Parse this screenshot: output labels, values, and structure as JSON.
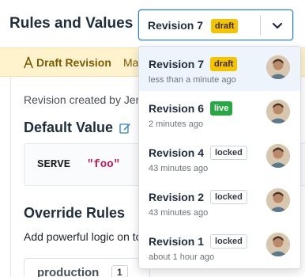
{
  "header": {
    "title": "Rules and Values"
  },
  "revision_select": {
    "selected_label": "Revision 7",
    "selected_badge": "draft",
    "chevron_icon": "chevron-down-icon"
  },
  "draft_banner": {
    "icon": "draft-icon",
    "title": "Draft Revision",
    "action_text": "Ma"
  },
  "content": {
    "created_text": "Revision created by Jer",
    "default_value_title": "Default Value",
    "edit_icon": "pencil-icon",
    "serve_keyword": "SERVE",
    "serve_value": "\"foo\"",
    "override_title": "Override Rules",
    "override_desc": "Add powerful logic on to",
    "env_tab": {
      "name": "production",
      "count": "1"
    }
  },
  "revisions": [
    {
      "label": "Revision 7",
      "badge": "draft",
      "time": "less than a minute ago",
      "active": true
    },
    {
      "label": "Revision 6",
      "badge": "live",
      "time": "2 minutes ago",
      "active": false
    },
    {
      "label": "Revision 4",
      "badge": "locked",
      "time": "43 minutes ago",
      "active": false
    },
    {
      "label": "Revision 2",
      "badge": "locked",
      "time": "43 minutes ago",
      "active": false
    },
    {
      "label": "Revision 1",
      "badge": "locked",
      "time": "about 1 hour ago",
      "active": false
    }
  ],
  "colors": {
    "accent": "#2f80c9",
    "draft": "#f5c400",
    "live": "#28a745",
    "banner_bg": "#fff3cd",
    "code_value": "#c2185b"
  }
}
